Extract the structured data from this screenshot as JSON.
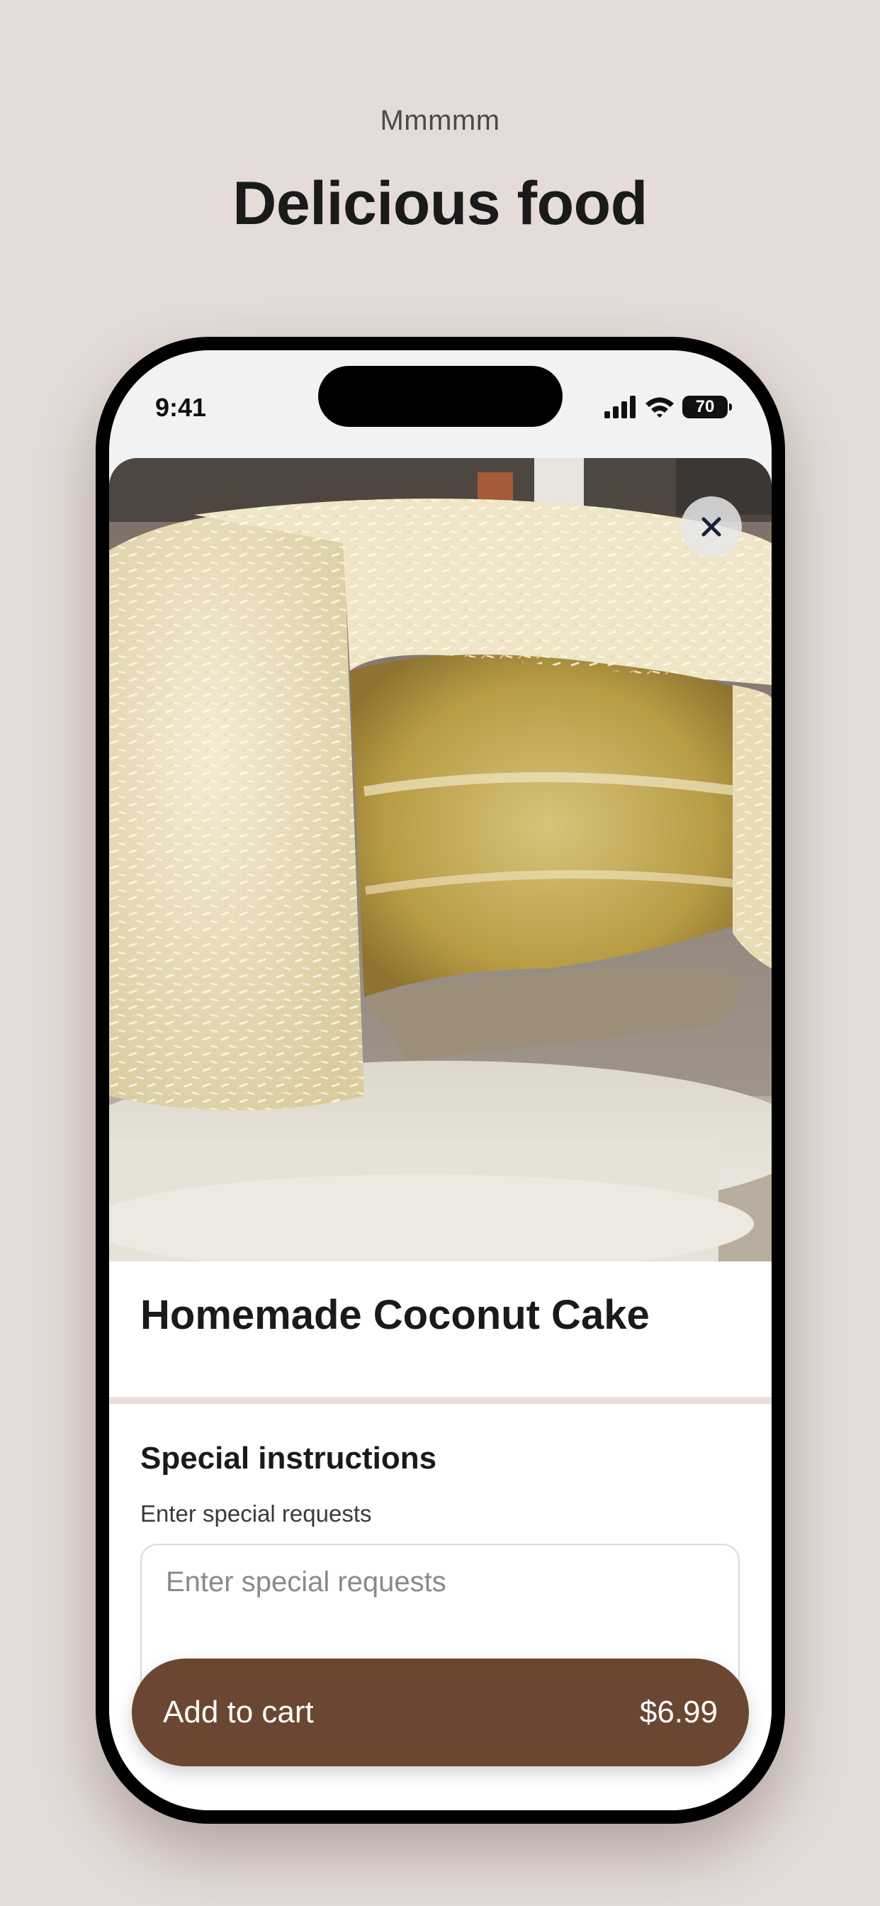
{
  "header": {
    "eyebrow": "Mmmmm",
    "title": "Delicious food"
  },
  "status_bar": {
    "time": "9:41",
    "battery": "70"
  },
  "item": {
    "photo_icon": "coconut-cake-photo",
    "name": "Homemade Coconut Cake"
  },
  "special_instructions": {
    "title": "Special instructions",
    "subtitle": "Enter special requests",
    "placeholder": "Enter special requests"
  },
  "cart": {
    "label": "Add to cart",
    "price": "$6.99"
  },
  "colors": {
    "background": "#e5dcd9",
    "button": "#6b4733"
  }
}
